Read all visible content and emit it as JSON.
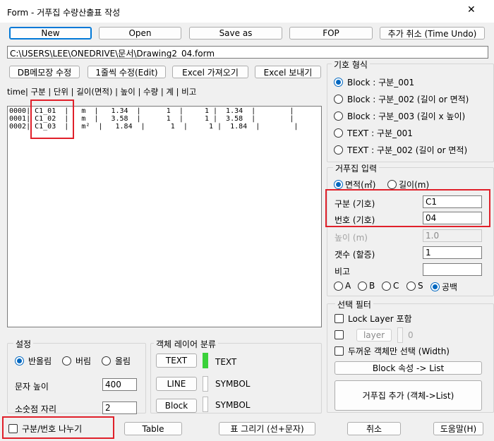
{
  "window": {
    "title": "Form - 거푸집 수량산출표 작성",
    "close_glyph": "✕"
  },
  "toolbar": {
    "new": "New",
    "open": "Open",
    "save_as": "Save as",
    "fop": "FOP",
    "undo_add": "추가 취소 (Time Undo)"
  },
  "path": "C:\\USERS\\LEE\\ONEDRIVE\\문서\\Drawing2_04.form",
  "actions": {
    "db_memo": "DB메모장 수정",
    "edit_one": "1줄씩 수정(Edit)",
    "excel_import": "Excel 가져오기",
    "excel_export": "Excel 보내기"
  },
  "list": {
    "header": "time|   구분   |  단위  |  길이(면적)  |  높이  |  수량  |  계  |  비고",
    "rows": [
      "0000| C1_01  |   m  |   1.34  |      1  |     1 |  1.34  |        |",
      "0001| C1_02  |   m  |   3.58  |      1  |     1 |  3.58  |        |",
      "0002| C1_03  |   m²  |   1.84  |      1  |     1 |  1.84  |        |"
    ]
  },
  "symbol_format": {
    "title": "기호 형식",
    "options": [
      {
        "label": "Block : 구분_001",
        "selected": true
      },
      {
        "label": "Block : 구분_002 (길이 or 면적)",
        "selected": false
      },
      {
        "label": "Block : 구분_003 (길이 x 높이)",
        "selected": false
      },
      {
        "label": "TEXT : 구분_001",
        "selected": false
      },
      {
        "label": "TEXT : 구분_002 (길이 or 면적)",
        "selected": false
      }
    ]
  },
  "formwork_input": {
    "title": "거푸집 입력",
    "unit_area": "면적(㎡)",
    "unit_length": "길이(m)",
    "div_label": "구분 (기호)",
    "div_value": "C1",
    "num_label": "번호 (기호)",
    "num_value": "04",
    "height_label": "높이 (m)",
    "height_value": "1.0",
    "count_label": "갯수 (할증)",
    "count_value": "1",
    "note_label": "비고",
    "note_value": "",
    "note_options": [
      {
        "label": "A",
        "selected": false
      },
      {
        "label": "B",
        "selected": false
      },
      {
        "label": "C",
        "selected": false
      },
      {
        "label": "S",
        "selected": false
      },
      {
        "label": "공백",
        "selected": true
      }
    ]
  },
  "filter": {
    "title": "선택 필터",
    "lock_layer": "Lock Layer 포함",
    "layer_button": "layer",
    "layer_value": "0",
    "thick_only": "두꺼운 객체만 선택 (Width)",
    "block_to_list": "Block 속성 -> List",
    "add_formwork": "거푸집 추가 (객체->List)"
  },
  "settings": {
    "title": "설정",
    "rounding": [
      {
        "label": "반올림",
        "selected": true
      },
      {
        "label": "버림",
        "selected": false
      },
      {
        "label": "올림",
        "selected": false
      }
    ],
    "text_height_label": "문자 높이",
    "text_height_value": "400",
    "decimal_label": "소숫점 자리",
    "decimal_value": "2"
  },
  "layers": {
    "title": "객체 레이어 분류",
    "items": [
      {
        "button": "TEXT",
        "name": "TEXT",
        "color": "#3ad13a"
      },
      {
        "button": "LINE",
        "name": "SYMBOL",
        "color": "#ffffff"
      },
      {
        "button": "Block",
        "name": "SYMBOL",
        "color": "#ffffff"
      }
    ]
  },
  "bottom": {
    "split_label": "구분/번호 나누기",
    "table": "Table",
    "draw_table": "표 그리기 (선+문자)",
    "cancel": "취소",
    "help": "도움말(H)"
  }
}
